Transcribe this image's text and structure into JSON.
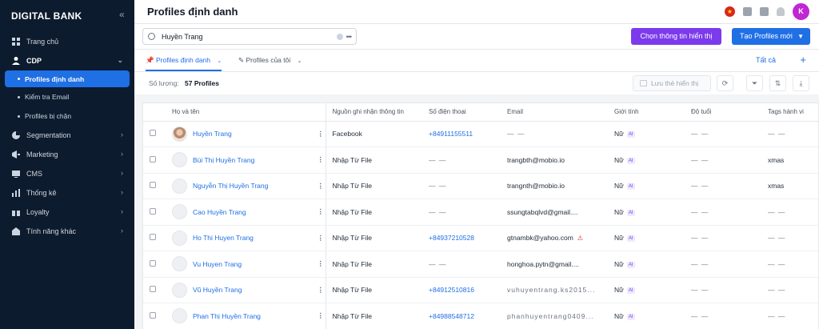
{
  "app": {
    "brand": "DIGITAL BANK",
    "collapse_icon": "«"
  },
  "sidebar": {
    "items": [
      {
        "label": "Trang chủ",
        "icon": "home-icon"
      },
      {
        "label": "CDP",
        "icon": "user-icon",
        "expanded": true
      },
      {
        "label": "Segmentation",
        "icon": "segment-icon"
      },
      {
        "label": "Marketing",
        "icon": "megaphone-icon"
      },
      {
        "label": "CMS",
        "icon": "monitor-icon"
      },
      {
        "label": "Thống kê",
        "icon": "chart-icon"
      },
      {
        "label": "Loyalty",
        "icon": "gift-icon"
      },
      {
        "label": "Tính năng khác",
        "icon": "apps-icon"
      }
    ],
    "cdp_sub": [
      {
        "label": "Profiles định danh",
        "active": true
      },
      {
        "label": "Kiểm tra Email"
      },
      {
        "label": "Profiles bị chặn"
      }
    ]
  },
  "header": {
    "title": "Profiles định danh",
    "avatar_initial": "K",
    "flag": "★"
  },
  "toolbar": {
    "search_value": "Huyền Trang",
    "choose_fields_label": "Chọn thông tin hiển thị",
    "create_label": "Tạo Profiles mới"
  },
  "tabs": [
    {
      "label": "Profiles định danh",
      "active": true
    },
    {
      "label": "Profiles của tôi"
    }
  ],
  "tab_all_label": "Tất cả",
  "count": {
    "label": "Số lượng:",
    "value": "57 Profiles"
  },
  "save_view_label": "Lưu thẻ hiển thị",
  "table": {
    "columns": [
      "Họ và tên",
      "Nguồn ghi nhận thông tin",
      "Số điện thoại",
      "Email",
      "Giới tính",
      "Độ tuổi",
      "Tags hành vi"
    ],
    "rows": [
      {
        "name": "Huyền Trang",
        "source": "Facebook",
        "phone": "+84911155511",
        "email": "— —",
        "gender": "Nữ",
        "age": "— —",
        "tags": "— —",
        "photo": true
      },
      {
        "name": "Bùi Thị Huyền Trang",
        "source": "Nhập Từ File",
        "phone": "— —",
        "email": "trangbth@mobio.io",
        "gender": "Nữ",
        "age": "— —",
        "tags": "xmas"
      },
      {
        "name": "Nguyễn Thị Huyền Trang",
        "source": "Nhập Từ File",
        "phone": "— —",
        "email": "trangnth@mobio.io",
        "gender": "Nữ",
        "age": "— —",
        "tags": "xmas"
      },
      {
        "name": "Cao Huyền Trang",
        "source": "Nhập Từ File",
        "phone": "— —",
        "email": "ssungtabqlvd@gmail....",
        "gender": "Nữ",
        "age": "— —",
        "tags": "— —"
      },
      {
        "name": "Ho Thi Huyen Trang",
        "source": "Nhập Từ File",
        "phone": "+84937210528",
        "email": "gtnambk@yahoo.com",
        "gender": "Nữ",
        "age": "— —",
        "tags": "— —",
        "warn": true
      },
      {
        "name": "Vu Huyen Trang",
        "source": "Nhập Từ File",
        "phone": "— —",
        "email": "honghoa.pytn@gmail....",
        "gender": "Nữ",
        "age": "— —",
        "tags": "— —"
      },
      {
        "name": "Vũ Huyền Trang",
        "source": "Nhập Từ File",
        "phone": "+84912510816",
        "email": "vuhuyentrang.ks2015...",
        "gender": "Nữ",
        "age": "— —",
        "tags": "— —"
      },
      {
        "name": "Phan Thị Huyền Trang",
        "source": "Nhập Từ File",
        "phone": "+84988548712",
        "email": "phanhuyentrang0409...",
        "gender": "Nữ",
        "age": "— —",
        "tags": "— —"
      }
    ],
    "ai_badge": "AI"
  },
  "colors": {
    "sidebar_bg": "#0d1b2e",
    "primary": "#1f6fe5",
    "purple": "#7c3aed"
  }
}
